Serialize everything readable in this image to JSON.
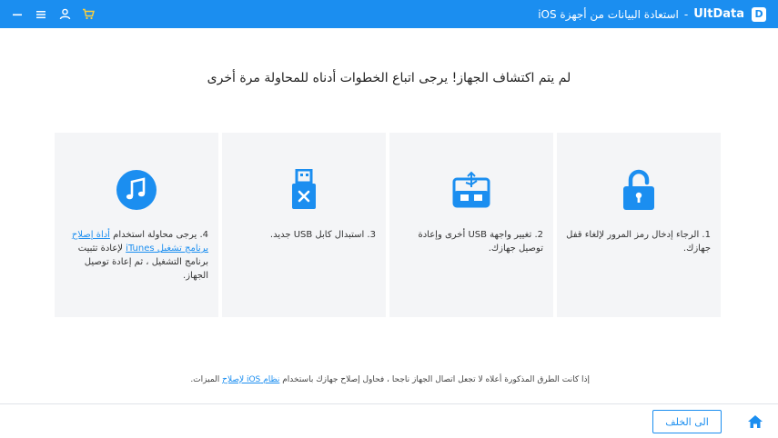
{
  "titlebar": {
    "app_name": "UltData",
    "separator": "-",
    "title": "استعادة البيانات من أجهزة iOS",
    "logo_letter": "D",
    "icons": [
      "minimize-icon",
      "menu-icon",
      "user-icon",
      "cart-icon"
    ]
  },
  "heading": "لم يتم اكتشاف الجهاز! يرجى اتباع الخطوات أدناه للمحاولة مرة أخرى",
  "cards": [
    {
      "icon": "lock-icon",
      "text": "1. الرجاء إدخال رمز المرور لإلغاء قفل جهازك."
    },
    {
      "icon": "usb-port-icon",
      "text": "2. تغيير واجهة USB أخرى وإعادة توصيل جهازك."
    },
    {
      "icon": "usb-cable-icon",
      "text": "3. استبدال كابل USB جديد."
    },
    {
      "icon": "itunes-icon",
      "text_before": "4. يرجى محاولة استخدام ",
      "link": "أداة إصلاح برنامج تشغيل iTunes",
      "text_after": " لإعادة تثبيت برنامج التشغيل ، ثم إعادة توصيل الجهاز."
    }
  ],
  "footer": {
    "before": "إذا كانت الطرق المذكورة أعلاه لا تجعل اتصال الجهاز ناجحا ، فحاول إصلاح جهازك باستخدام ",
    "link": "نظام iOS لإصلاح",
    "after": " الميزات."
  },
  "back_label": "الى الخلف",
  "colors": {
    "accent": "#1b8ef0",
    "card_bg": "#f4f5f7"
  }
}
